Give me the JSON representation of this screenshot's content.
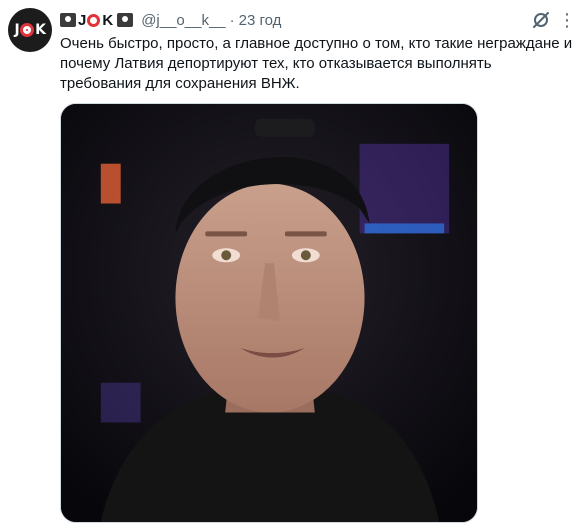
{
  "tweet": {
    "avatar_text": "J K",
    "display_name": "J K",
    "handle": "@j__o__k__",
    "dot": "·",
    "time": "23 год",
    "text": "Очень быстро, просто, а главное доступно о том, кто такие неграждане и\nпочему Латвия депортируют тех, кто  отказывается выполнять\nтребования для сохранения ВНЖ."
  },
  "icons": {
    "grok": "grok-icon",
    "more": "more-icon"
  },
  "media": {
    "type": "video-thumbnail"
  },
  "colors": {
    "text": "#0f1419",
    "muted": "#536471",
    "brand_red": "#e0343a"
  }
}
